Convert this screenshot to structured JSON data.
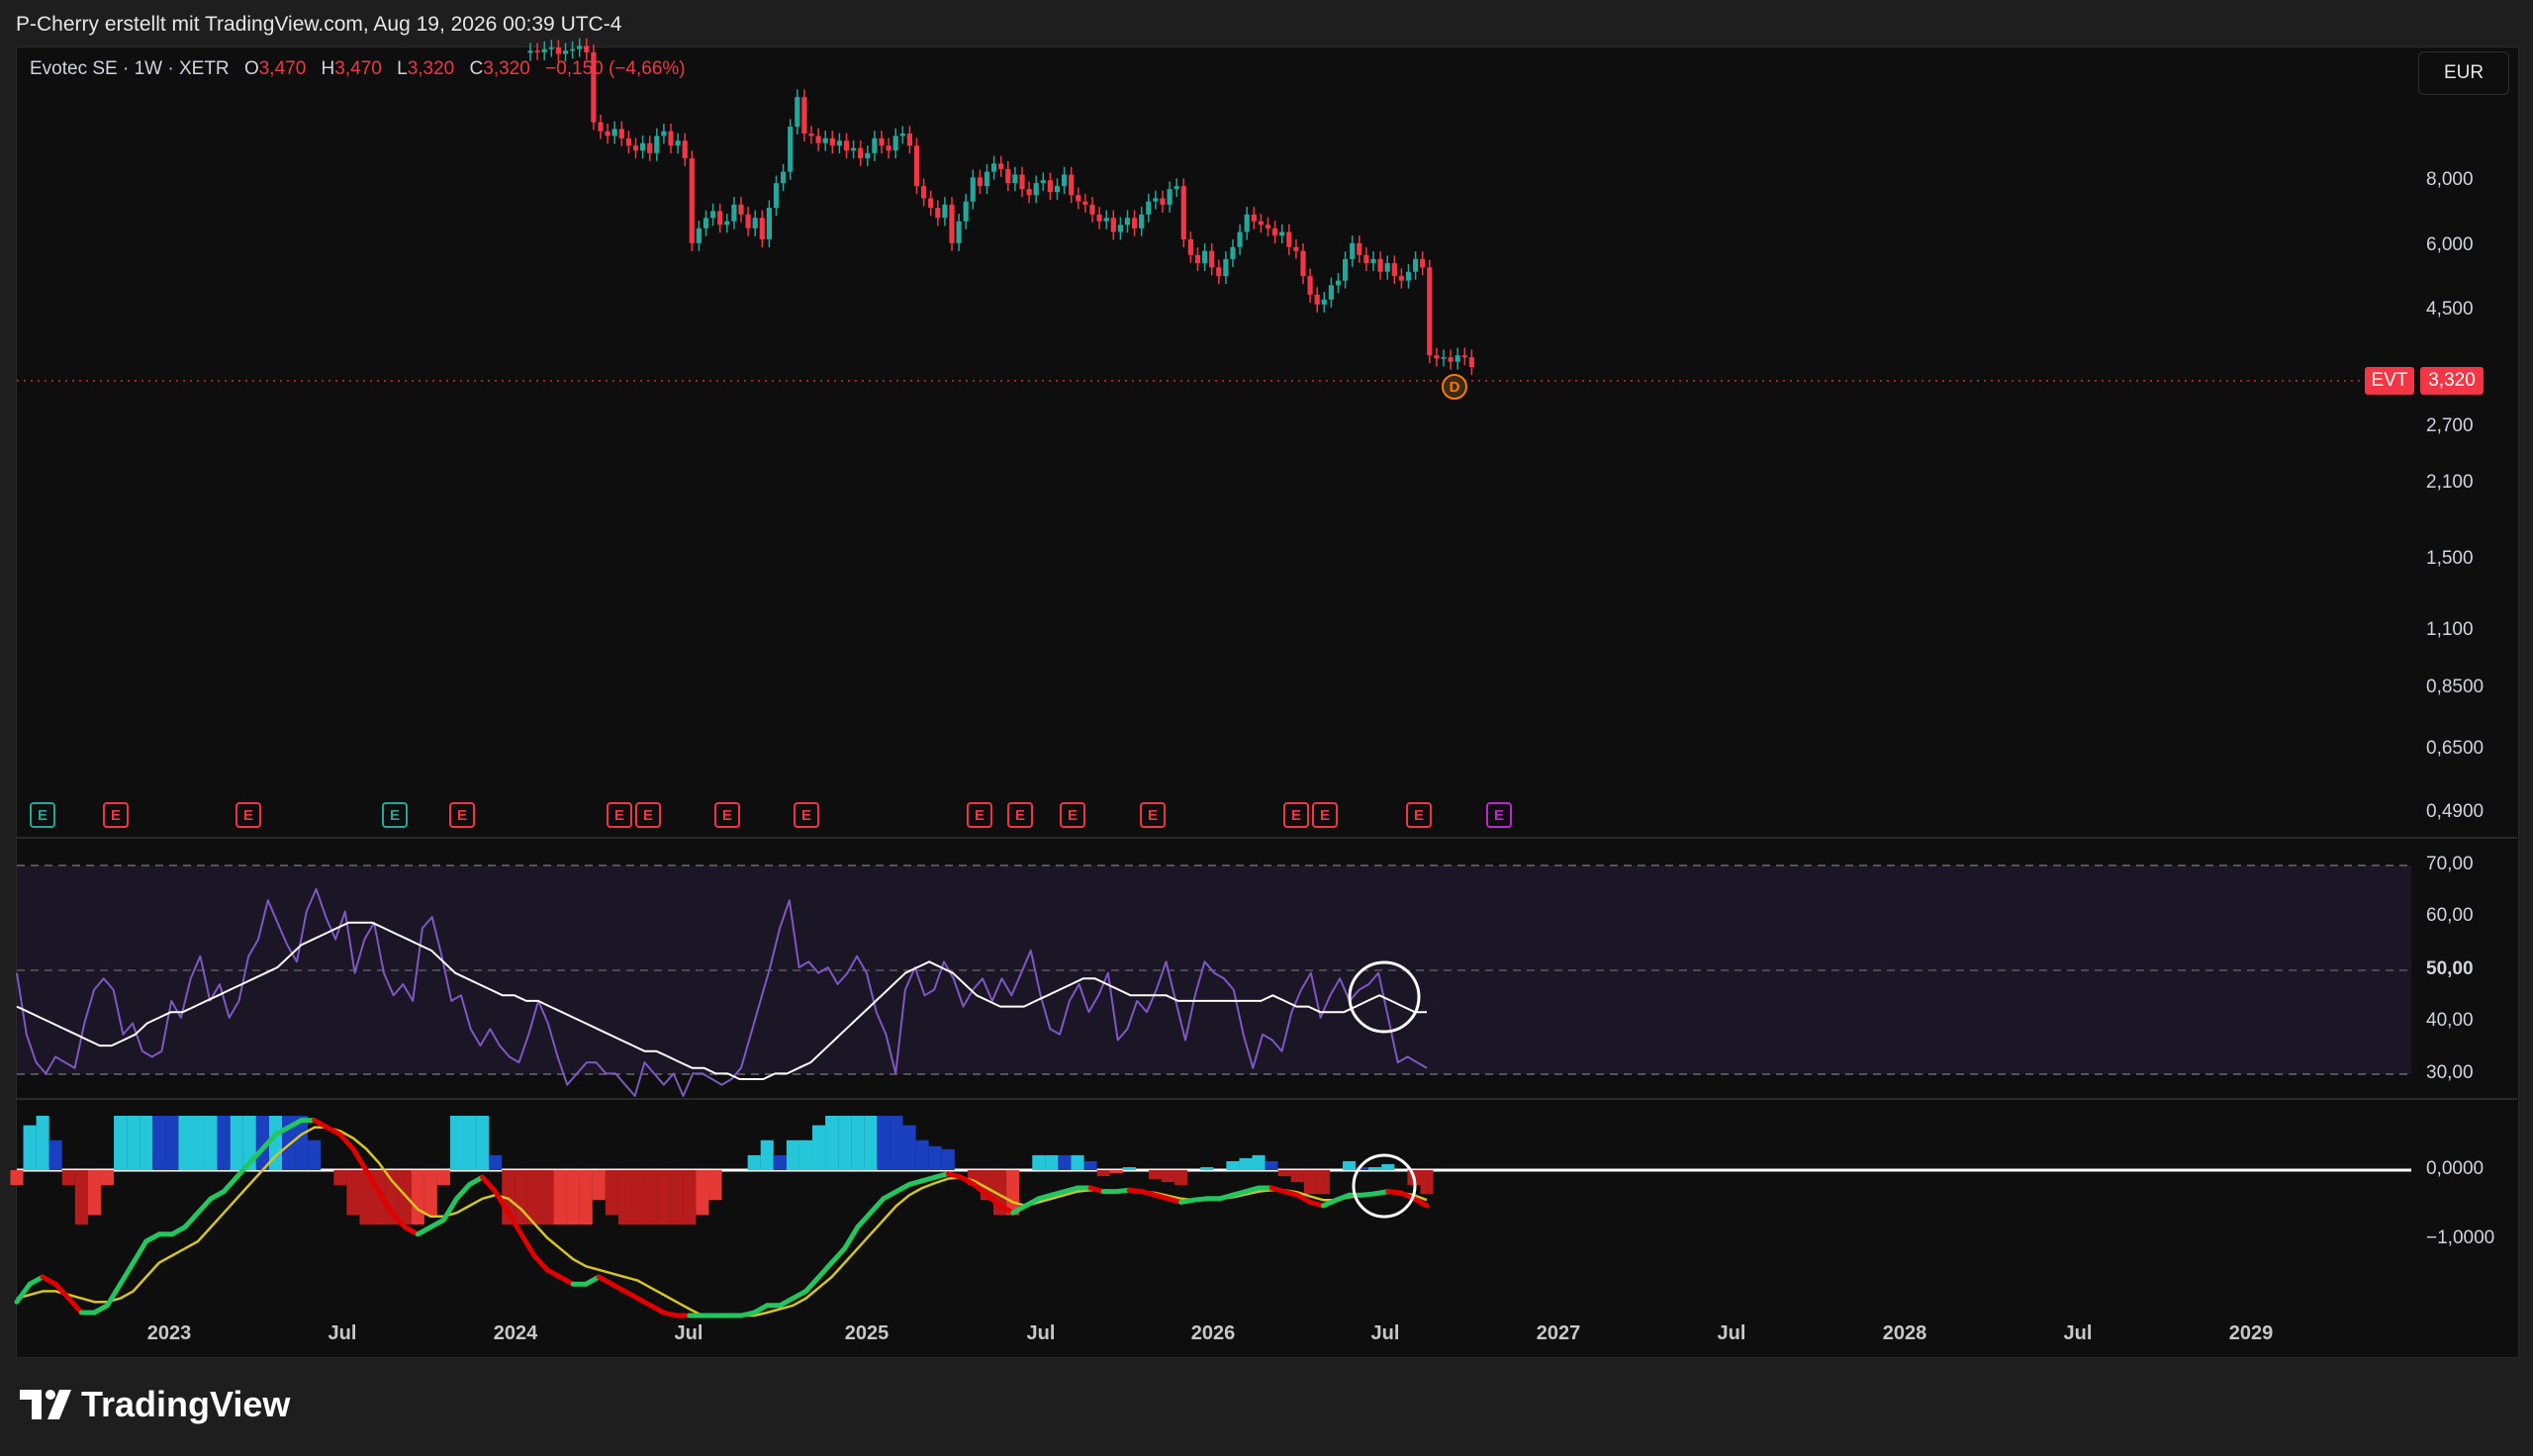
{
  "header": {
    "text": "P-Cherry erstellt mit TradingView.com, Aug 19, 2026 00:39 UTC-4"
  },
  "legend": {
    "symbol": "Evotec SE · 1W · XETR",
    "o_label": "O",
    "o_value": "3,470",
    "h_label": "H",
    "h_value": "3,470",
    "l_label": "L",
    "l_value": "3,320",
    "c_label": "C",
    "c_value": "3,320",
    "change": "−0,150 (−4,66%)"
  },
  "currency_button": "EUR",
  "price_axis": [
    "8,000",
    "6,000",
    "4,500",
    "2,700",
    "2,100",
    "1,500",
    "1,100",
    "0,8500",
    "0,6500",
    "0,4900"
  ],
  "price_tag": {
    "symbol": "EVT",
    "value": "3,320"
  },
  "rsi_axis": [
    "70,00",
    "60,00",
    "50,00",
    "40,00",
    "30,00"
  ],
  "macd_axis": [
    "0,0000",
    "−1,0000"
  ],
  "time_axis": [
    "2023",
    "Jul",
    "2024",
    "Jul",
    "2025",
    "Jul",
    "2026",
    "Jul",
    "2027",
    "Jul",
    "2028",
    "Jul",
    "2029"
  ],
  "earnings_markers": [
    {
      "label": "E",
      "kind": "green"
    },
    {
      "label": "E",
      "kind": "red"
    },
    {
      "label": "E",
      "kind": "red"
    },
    {
      "label": "E",
      "kind": "green"
    },
    {
      "label": "E",
      "kind": "red"
    },
    {
      "label": "E",
      "kind": "red"
    },
    {
      "label": "E",
      "kind": "red"
    },
    {
      "label": "E",
      "kind": "red"
    },
    {
      "label": "E",
      "kind": "red"
    },
    {
      "label": "E",
      "kind": "red"
    },
    {
      "label": "E",
      "kind": "red"
    },
    {
      "label": "E",
      "kind": "red"
    },
    {
      "label": "E",
      "kind": "red"
    },
    {
      "label": "E",
      "kind": "red"
    },
    {
      "label": "E",
      "kind": "red"
    },
    {
      "label": "E",
      "kind": "red"
    },
    {
      "label": "E",
      "kind": "purple"
    }
  ],
  "dividend_marker": "D",
  "brand": "TradingView",
  "colors": {
    "up": "#26a69a",
    "down": "#f23645",
    "rsi": "#7e57c2",
    "macd": "#22c55e",
    "signal": "#d4c424",
    "hist_up": "#26c6da",
    "hist_down": "#b71c1c"
  },
  "chart_data": [
    {
      "type": "candlestick",
      "title": "Evotec SE · 1W · XETR",
      "y_scale": "log",
      "ylim": [
        0.43,
        14
      ],
      "current": 3.32,
      "closes": [
        13.8,
        13.7,
        13.9,
        14.0,
        13.6,
        13.8,
        13.9,
        14.1,
        13.7,
        10.0,
        9.6,
        9.4,
        9.7,
        9.3,
        9.0,
        8.8,
        9.1,
        8.7,
        9.4,
        9.6,
        9.0,
        9.2,
        8.5,
        5.8,
        6.2,
        6.5,
        6.7,
        6.3,
        6.4,
        6.9,
        6.6,
        6.2,
        6.5,
        5.9,
        6.8,
        7.6,
        8.0,
        9.8,
        11.2,
        9.5,
        9.4,
        9.1,
        9.3,
        9.0,
        9.2,
        8.8,
        8.9,
        8.5,
        8.7,
        9.3,
        9.0,
        8.8,
        9.4,
        9.5,
        9.0,
        7.5,
        7.1,
        6.8,
        6.5,
        6.9,
        5.8,
        6.4,
        7.0,
        7.8,
        7.5,
        8.0,
        8.3,
        8.1,
        7.6,
        7.9,
        7.4,
        7.2,
        7.6,
        7.7,
        7.3,
        7.5,
        7.9,
        7.2,
        7.0,
        6.9,
        6.6,
        6.4,
        6.5,
        6.1,
        6.3,
        6.5,
        6.2,
        6.6,
        7.0,
        7.1,
        6.9,
        7.4,
        7.5,
        5.9,
        5.5,
        5.3,
        5.6,
        5.2,
        5.0,
        5.4,
        5.7,
        6.1,
        6.6,
        6.4,
        6.3,
        6.2,
        6.0,
        6.1,
        5.7,
        5.6,
        5.0,
        4.6,
        4.4,
        4.5,
        4.8,
        4.9,
        5.4,
        5.8,
        5.5,
        5.3,
        5.4,
        5.1,
        5.3,
        5.0,
        4.9,
        5.1,
        5.4,
        5.2,
        3.5,
        3.45,
        3.47,
        3.4,
        3.5,
        3.47,
        3.32
      ]
    },
    {
      "type": "line",
      "title": "RSI",
      "ylim": [
        27,
        73
      ],
      "guides": [
        30,
        50,
        70
      ],
      "series": [
        {
          "values": [
            49,
            38,
            33,
            31,
            34,
            33,
            32,
            40,
            46,
            48,
            46,
            38,
            40,
            35,
            34,
            35,
            44,
            41,
            48,
            52,
            44,
            47,
            41,
            44,
            52,
            55,
            62,
            58,
            54,
            51,
            60,
            64,
            59,
            55,
            60,
            49,
            55,
            58,
            49,
            45,
            47,
            44,
            57,
            59,
            52,
            44,
            45,
            39,
            36,
            39,
            36,
            34,
            33,
            38,
            44,
            40,
            34,
            29,
            31,
            33,
            33,
            31,
            31,
            29,
            27,
            33,
            31,
            29,
            31,
            27,
            31,
            31,
            30,
            29,
            30,
            32,
            38,
            44,
            50,
            57,
            62,
            50,
            51,
            49,
            50,
            47,
            49,
            52,
            49,
            42,
            38,
            31,
            46,
            50,
            45,
            46,
            51,
            48,
            43,
            46,
            48,
            44,
            48,
            45,
            49,
            53,
            45,
            39,
            38,
            44,
            47,
            42,
            45,
            49,
            37,
            39,
            44,
            42,
            46,
            51,
            44,
            37,
            45,
            51,
            49,
            48,
            46,
            38,
            32,
            38,
            37,
            35,
            42,
            46,
            49,
            41,
            45,
            48,
            44,
            46,
            47,
            49,
            41,
            33,
            34,
            33,
            32
          ]
        },
        {
          "values": [
            43,
            42,
            41,
            40,
            39,
            38,
            37,
            36,
            36,
            37,
            38,
            40,
            41,
            42,
            42,
            43,
            44,
            45,
            46,
            47,
            48,
            49,
            50,
            52,
            54,
            55,
            56,
            57,
            58,
            58,
            58,
            57,
            56,
            55,
            54,
            53,
            51,
            49,
            48,
            47,
            46,
            45,
            45,
            44,
            44,
            43,
            42,
            41,
            40,
            39,
            38,
            37,
            36,
            35,
            35,
            34,
            33,
            32,
            32,
            31,
            31,
            30,
            30,
            30,
            31,
            31,
            32,
            33,
            35,
            37,
            39,
            41,
            43,
            45,
            47,
            49,
            50,
            51,
            50,
            49,
            47,
            45,
            44,
            43,
            43,
            43,
            44,
            45,
            46,
            47,
            48,
            48,
            47,
            46,
            45,
            45,
            45,
            45,
            44,
            44,
            44,
            44,
            44,
            44,
            44,
            44,
            45,
            44,
            43,
            43,
            42,
            42,
            42,
            43,
            44,
            45,
            44,
            43,
            42,
            42
          ]
        }
      ]
    },
    {
      "type": "line",
      "title": "MACD",
      "ylim": [
        -1.9,
        0.8
      ],
      "series": [
        {
          "values": [
            -1.85,
            -1.6,
            -1.5,
            -1.6,
            -1.8,
            -2.0,
            -2.0,
            -1.9,
            -1.6,
            -1.3,
            -1.0,
            -0.9,
            -0.9,
            -0.8,
            -0.6,
            -0.4,
            -0.3,
            -0.1,
            0.1,
            0.3,
            0.5,
            0.6,
            0.7,
            0.7,
            0.6,
            0.5,
            0.3,
            0.0,
            -0.3,
            -0.6,
            -0.8,
            -0.9,
            -0.8,
            -0.7,
            -0.4,
            -0.2,
            -0.1,
            -0.3,
            -0.6,
            -0.9,
            -1.2,
            -1.4,
            -1.5,
            -1.6,
            -1.6,
            -1.5,
            -1.6,
            -1.7,
            -1.8,
            -1.9,
            -2.0,
            -2.1,
            -2.2,
            -2.2,
            -2.2,
            -2.1,
            -2.1,
            -2.0,
            -1.9,
            -1.9,
            -1.8,
            -1.7,
            -1.5,
            -1.3,
            -1.1,
            -0.8,
            -0.6,
            -0.4,
            -0.3,
            -0.2,
            -0.15,
            -0.1,
            -0.05,
            -0.1,
            -0.2,
            -0.35,
            -0.5,
            -0.6,
            -0.5,
            -0.4,
            -0.35,
            -0.3,
            -0.25,
            -0.25,
            -0.3,
            -0.3,
            -0.28,
            -0.3,
            -0.35,
            -0.4,
            -0.45,
            -0.42,
            -0.4,
            -0.4,
            -0.35,
            -0.3,
            -0.25,
            -0.25,
            -0.3,
            -0.35,
            -0.45,
            -0.5,
            -0.42,
            -0.35,
            -0.35,
            -0.33,
            -0.3,
            -0.32,
            -0.4,
            -0.5
          ]
        },
        {
          "values": [
            -1.8,
            -1.75,
            -1.7,
            -1.7,
            -1.75,
            -1.8,
            -1.85,
            -1.85,
            -1.8,
            -1.7,
            -1.5,
            -1.3,
            -1.2,
            -1.1,
            -1.0,
            -0.8,
            -0.6,
            -0.4,
            -0.2,
            0.0,
            0.2,
            0.35,
            0.5,
            0.6,
            0.6,
            0.55,
            0.45,
            0.3,
            0.1,
            -0.15,
            -0.35,
            -0.55,
            -0.65,
            -0.65,
            -0.6,
            -0.5,
            -0.4,
            -0.35,
            -0.4,
            -0.55,
            -0.75,
            -0.95,
            -1.1,
            -1.25,
            -1.35,
            -1.4,
            -1.45,
            -1.5,
            -1.55,
            -1.65,
            -1.75,
            -1.85,
            -1.95,
            -2.05,
            -2.1,
            -2.1,
            -2.1,
            -2.05,
            -2.0,
            -1.95,
            -1.9,
            -1.8,
            -1.65,
            -1.5,
            -1.3,
            -1.1,
            -0.9,
            -0.7,
            -0.5,
            -0.35,
            -0.25,
            -0.18,
            -0.12,
            -0.1,
            -0.15,
            -0.25,
            -0.35,
            -0.45,
            -0.5,
            -0.45,
            -0.4,
            -0.35,
            -0.3,
            -0.28,
            -0.28,
            -0.29,
            -0.29,
            -0.3,
            -0.32,
            -0.36,
            -0.4,
            -0.42,
            -0.41,
            -0.4,
            -0.38,
            -0.34,
            -0.3,
            -0.28,
            -0.28,
            -0.31,
            -0.37,
            -0.42,
            -0.42,
            -0.38,
            -0.36,
            -0.34,
            -0.32,
            -0.32,
            -0.35,
            -0.42
          ]
        }
      ]
    }
  ]
}
